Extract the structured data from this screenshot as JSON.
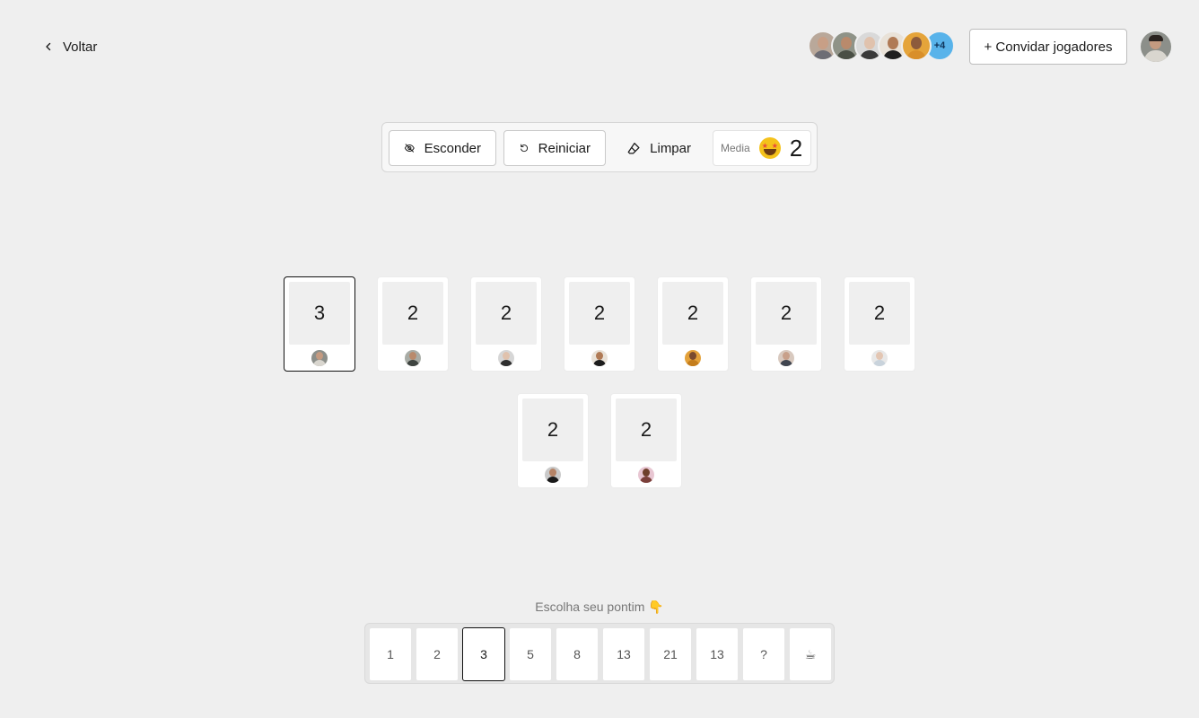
{
  "nav": {
    "back_label": "Voltar"
  },
  "header": {
    "invite_label": "+ Convidar jogadores",
    "more_players": "+4",
    "avatars": [
      {
        "skin": "#c89f86",
        "shirt": "#6d6d75",
        "bg": "#b9a89a"
      },
      {
        "skin": "#b98a6c",
        "shirt": "#4a4f45",
        "bg": "#8f9388"
      },
      {
        "skin": "#e0c2ad",
        "shirt": "#3a3a3a",
        "bg": "#d9d9d9"
      },
      {
        "skin": "#b07a55",
        "shirt": "#1f1f1f",
        "bg": "#e9e2d8"
      },
      {
        "skin": "#8d5b3c",
        "shirt": "#d98f2a",
        "bg": "#e5a43a"
      }
    ]
  },
  "toolbar": {
    "hide_label": "Esconder",
    "restart_label": "Reiniciar",
    "clear_label": "Limpar",
    "average_label": "Media",
    "average_value": "2"
  },
  "table": {
    "cards": [
      {
        "value": "3",
        "selected": true,
        "skin": "#c49a80",
        "shirt": "#d9d6cf",
        "bg": "#8c8f8a"
      },
      {
        "value": "2",
        "selected": false,
        "skin": "#b98a6c",
        "shirt": "#3e4440",
        "bg": "#a8aca6"
      },
      {
        "value": "2",
        "selected": false,
        "skin": "#e0c2ad",
        "shirt": "#2e2e2e",
        "bg": "#d6d6d6"
      },
      {
        "value": "2",
        "selected": false,
        "skin": "#b07a55",
        "shirt": "#1c1c1c",
        "bg": "#e9e2d8"
      },
      {
        "value": "2",
        "selected": false,
        "skin": "#7a4a2e",
        "shirt": "#c47d1c",
        "bg": "#e3a13a"
      },
      {
        "value": "2",
        "selected": false,
        "skin": "#c8a08a",
        "shirt": "#40454f",
        "bg": "#d8c9bf"
      },
      {
        "value": "2",
        "selected": false,
        "skin": "#e3c6b3",
        "shirt": "#c9d3dc",
        "bg": "#e8e8e8"
      },
      {
        "value": "2",
        "selected": false,
        "skin": "#b58366",
        "shirt": "#1a1a1a",
        "bg": "#c9c9c9"
      },
      {
        "value": "2",
        "selected": false,
        "skin": "#6e3f2a",
        "shirt": "#7b3f3a",
        "bg": "#e8c6d2"
      }
    ]
  },
  "picker": {
    "label": "Escolha seu pontim 👇",
    "options": [
      "1",
      "2",
      "3",
      "5",
      "8",
      "13",
      "21",
      "13",
      "?",
      "☕"
    ],
    "selected_index": 2
  }
}
